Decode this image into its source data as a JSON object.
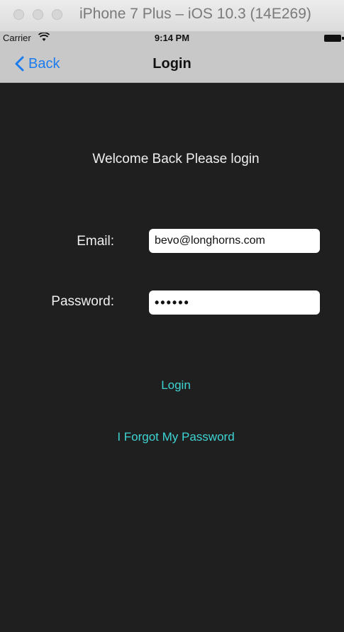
{
  "window": {
    "title": "iPhone 7 Plus – iOS 10.3 (14E269)"
  },
  "statusbar": {
    "carrier": "Carrier",
    "time": "9:14 PM"
  },
  "navbar": {
    "back_label": "Back",
    "title": "Login"
  },
  "main": {
    "welcome": "Welcome Back Please login",
    "email_label": "Email:",
    "email_value": "bevo@longhorns.com",
    "password_label": "Password:",
    "password_value": "••••••",
    "login_label": "Login",
    "forgot_label": "I Forgot My Password"
  },
  "colors": {
    "background": "#1f1f1f",
    "link": "#3fd4d4",
    "back_blue": "#1b7cf0",
    "bar": "#c8c8c8"
  },
  "icons": [
    "wifi-icon",
    "battery-icon",
    "chevron-left-icon"
  ]
}
